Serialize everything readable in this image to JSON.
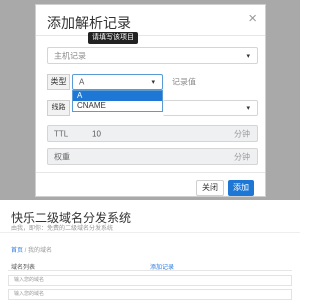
{
  "modal": {
    "title": "添加解析记录",
    "close_icon": "×",
    "tooltip": "请填写该项目",
    "host_field": {
      "placeholder": "主机记录",
      "caret": "▾"
    },
    "type_label": "类型",
    "type_select": {
      "value": "A",
      "caret": "▾"
    },
    "type_options": [
      "A",
      "CNAME"
    ],
    "record_value_placeholder": "记录值",
    "line_label": "线路",
    "line_caret": "▾",
    "ttl": {
      "label": "TTL",
      "value": "10",
      "suffix": "分钟"
    },
    "weight": {
      "label": "权重",
      "suffix": "分钟"
    },
    "buttons": {
      "close": "关闭",
      "add": "添加"
    }
  },
  "page": {
    "title": "快乐二级域名分发系统",
    "subtitle": "由我，即你：免费的二级域名分发系统",
    "breadcrumb": {
      "home": "首页",
      "separator": " / ",
      "current": "我的域名"
    },
    "columns": {
      "hostname": "域名列表",
      "action": "添加记录"
    },
    "inputs": [
      "输入您的域名",
      "输入您的域名"
    ]
  },
  "colors": {
    "accent": "#1e77d4",
    "backdrop": "#a9a9a9"
  }
}
